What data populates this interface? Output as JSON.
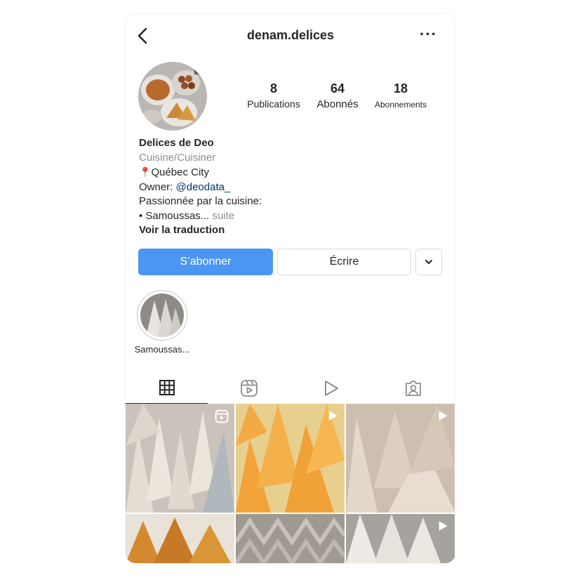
{
  "header": {
    "username": "denam.delices",
    "back_icon": "chevron-left-icon",
    "more_icon": "more-horizontal-icon"
  },
  "stats": [
    {
      "value": "8",
      "label": "Publications"
    },
    {
      "value": "64",
      "label": "Abonnés"
    },
    {
      "value": "18",
      "label": "Abonnements"
    }
  ],
  "bio": {
    "name": "Delices de Deo",
    "category": "Cuisine/Cuisiner",
    "location_pin": "📍",
    "location": "Québec City",
    "owner_prefix": "Owner: ",
    "owner_handle": "@deodata_",
    "line_passion": "Passionnée par la cuisine:",
    "line_item": "• Samoussas...",
    "more": " suite",
    "translate": "Voir la traduction"
  },
  "actions": {
    "follow": "S’abonner",
    "message": "Écrire",
    "dropdown_icon": "chevron-down-icon"
  },
  "highlight": {
    "label": "Samoussas..."
  },
  "tabs": [
    {
      "name": "grid-icon"
    },
    {
      "name": "reels-icon"
    },
    {
      "name": "video-play-icon"
    },
    {
      "name": "tagged-icon"
    }
  ],
  "colors": {
    "accent": "#4a96f2",
    "link": "#00376b",
    "muted": "#8e8e8e"
  }
}
